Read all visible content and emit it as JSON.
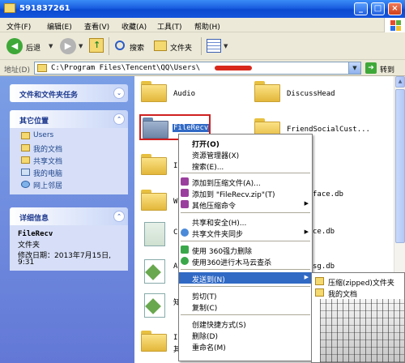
{
  "window": {
    "title": "591837261"
  },
  "menubar": {
    "items": [
      "文件(F)",
      "编辑(E)",
      "查看(V)",
      "收藏(A)",
      "工具(T)",
      "帮助(H)"
    ]
  },
  "toolbar": {
    "back": "后退",
    "search": "搜索",
    "folders": "文件夹"
  },
  "address": {
    "label": "地址(D)",
    "path": "C:\\Program Files\\Tencent\\QQ\\Users\\",
    "go": "转到"
  },
  "left": {
    "tasks_title": "文件和文件夹任务",
    "places_title": "其它位置",
    "places": [
      "Users",
      "我的文档",
      "共享文档",
      "我的电脑",
      "网上邻居"
    ],
    "details_title": "详细信息",
    "detail_name": "FileRecv",
    "detail_type": "文件夹",
    "detail_modified_label": "修改日期：2013年7月15日,",
    "detail_modified_time": "9:31"
  },
  "files": {
    "audio": "Audio",
    "discuss": "DiscussHead",
    "filerecv": "FileRecv",
    "friend": "FriendSocialCust...",
    "partial_ic1": "Ic",
    "partial_w": "W",
    "partial_ic2": "Ic",
    "right_db1": "face.db",
    "right_db2": "ce.db",
    "right_db3": "sg.db",
    "left_c": "C",
    "left_a": "A",
    "left_zhi": "知",
    "left_qi": "其"
  },
  "context_menu": {
    "open": "打开(O)",
    "explorer": "资源管理器(X)",
    "search": "搜索(E)...",
    "add_archive": "添加到压缩文件(A)...",
    "add_zip": "添加到 \"FileRecv.zip\"(T)",
    "other_zip": "其他压缩命令",
    "sharing": "共享和安全(H)...",
    "sync": "共享文件夹同步",
    "delete360": "使用 360强力删除",
    "scan360": "使用360进行木马云查杀",
    "send_to": "发送到(N)",
    "cut": "剪切(T)",
    "copy": "复制(C)",
    "shortcut": "创建快捷方式(S)",
    "delete": "删除(D)",
    "rename": "重命名(M)"
  },
  "submenu": {
    "zip": "压缩(zipped)文件夹",
    "docs": "我的文档"
  }
}
